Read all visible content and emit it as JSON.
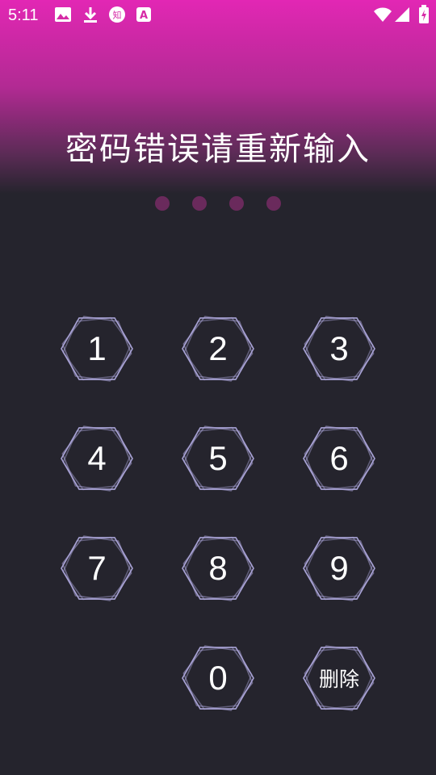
{
  "status_bar": {
    "time": "5:11",
    "icons": [
      "image-icon",
      "download-icon",
      "zhihu-icon",
      "a-app-icon",
      "wifi-icon",
      "signal-icon",
      "battery-charging-icon"
    ]
  },
  "prompt": "密码错误请重新输入",
  "pin_length": 4,
  "keypad": {
    "keys": [
      "1",
      "2",
      "3",
      "4",
      "5",
      "6",
      "7",
      "8",
      "9",
      "0"
    ],
    "delete_label": "删除"
  },
  "colors": {
    "accent_top": "#e227b4",
    "background": "#25242d",
    "hex_stroke": "#a9a3d6",
    "dot": "#6a2a5c"
  }
}
